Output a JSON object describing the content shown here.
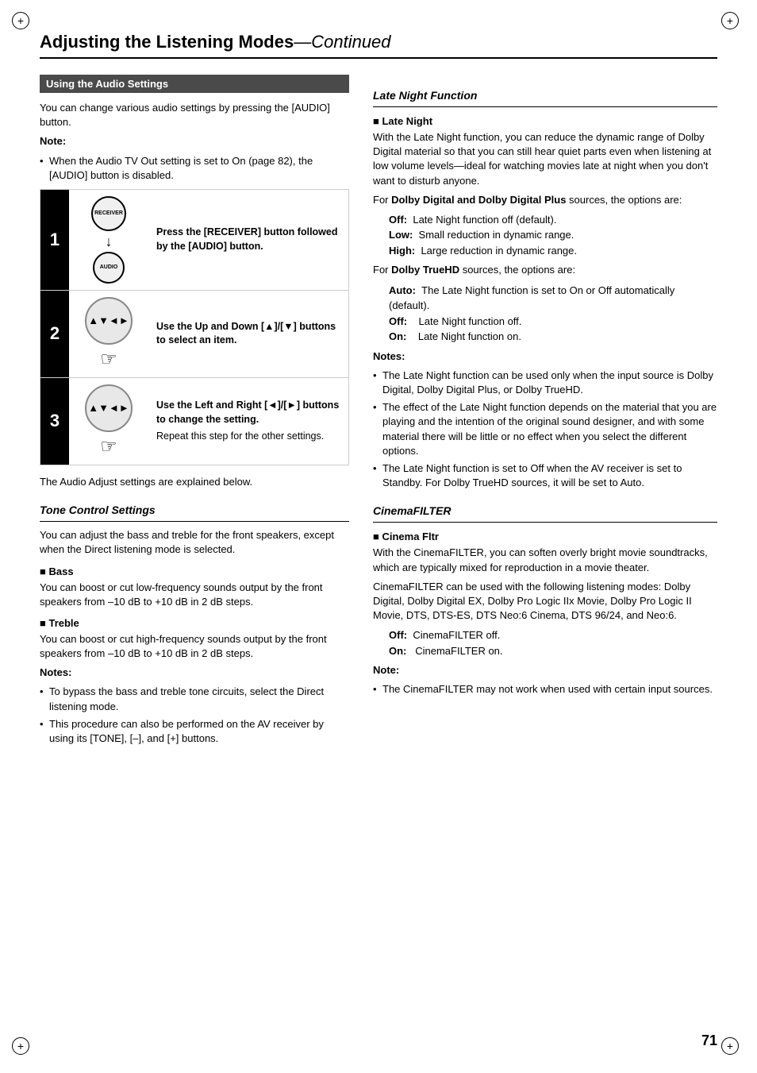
{
  "page": {
    "title": "Adjusting the Listening Modes",
    "title_continued": "—Continued",
    "page_number": "71"
  },
  "left_col": {
    "section_header": "Using the Audio Settings",
    "intro": "You can change various audio settings by pressing the [AUDIO] button.",
    "note_label": "Note:",
    "note_text": "When the Audio TV Out setting is set to On (page 82), the [AUDIO] button is disabled.",
    "steps": [
      {
        "num": "1",
        "text": "Press the [RECEIVER] button followed by the [AUDIO] button."
      },
      {
        "num": "2",
        "text": "Use the Up and Down [▲]/[▼] buttons to select an item."
      },
      {
        "num": "3",
        "text": "Use the Left and Right [◄]/[►] buttons to change the setting.",
        "subtext": "Repeat this step for the other settings."
      }
    ],
    "after_steps": "The Audio Adjust settings are explained below.",
    "tone_control": {
      "title": "Tone Control Settings",
      "intro": "You can adjust the bass and treble for the front speakers, except when the Direct listening mode is selected.",
      "bass_title": "Bass",
      "bass_text": "You can boost or cut low-frequency sounds output by the front speakers from –10 dB to +10 dB in 2 dB steps.",
      "treble_title": "Treble",
      "treble_text": "You can boost or cut high-frequency sounds output by the front speakers from –10 dB to +10 dB in 2 dB steps.",
      "notes_label": "Notes:",
      "notes": [
        "To bypass the bass and treble tone circuits, select the Direct listening mode.",
        "This procedure can also be performed on the AV receiver by using its [TONE], [–], and [+] buttons."
      ]
    }
  },
  "right_col": {
    "late_night": {
      "section_title": "Late Night Function",
      "subsection_title": "Late Night",
      "intro": "With the Late Night function, you can reduce the dynamic range of Dolby Digital material so that you can still hear quiet parts even when listening at low volume levels—ideal for watching movies late at night when you don't want to disturb anyone.",
      "dolby_dd_intro": "For Dolby Digital and Dolby Digital Plus sources, the options are:",
      "dolby_dd_options": [
        {
          "label": "Off:",
          "text": "Late Night function off (default)."
        },
        {
          "label": "Low:",
          "text": "Small reduction in dynamic range."
        },
        {
          "label": "High:",
          "text": "Large reduction in dynamic range."
        }
      ],
      "dolby_truehd_intro": "For Dolby TrueHD sources, the options are:",
      "dolby_truehd_options": [
        {
          "label": "Auto:",
          "text": "The Late Night function is set to On or Off automatically (default)."
        },
        {
          "label": "Off:",
          "text": "Late Night function off."
        },
        {
          "label": "On:",
          "text": "Late Night function on."
        }
      ],
      "notes_label": "Notes:",
      "notes": [
        "The Late Night function can be used only when the input source is Dolby Digital, Dolby Digital Plus, or Dolby TrueHD.",
        "The effect of the Late Night function depends on the material that you are playing and the intention of the original sound designer, and with some material there will be little or no effect when you select the different options.",
        "The Late Night function is set to Off when the AV receiver is set to Standby. For Dolby TrueHD sources, it will be set to Auto."
      ]
    },
    "cinema_filter": {
      "section_title": "CinemaFILTER",
      "subsection_title": "Cinema Fltr",
      "intro": "With the CinemaFILTER, you can soften overly bright movie soundtracks, which are typically mixed for reproduction in a movie theater.",
      "modes_intro": "CinemaFILTER can be used with the following listening modes: Dolby Digital, Dolby Digital EX, Dolby Pro Logic IIx Movie, Dolby Pro Logic II Movie, DTS, DTS-ES, DTS Neo:6 Cinema, DTS 96/24, and Neo:6.",
      "options": [
        {
          "label": "Off:",
          "text": "CinemaFILTER off."
        },
        {
          "label": "On:",
          "text": "CinemaFILTER on."
        }
      ],
      "note_label": "Note:",
      "note": "The CinemaFILTER may not work when used with certain input sources."
    }
  }
}
